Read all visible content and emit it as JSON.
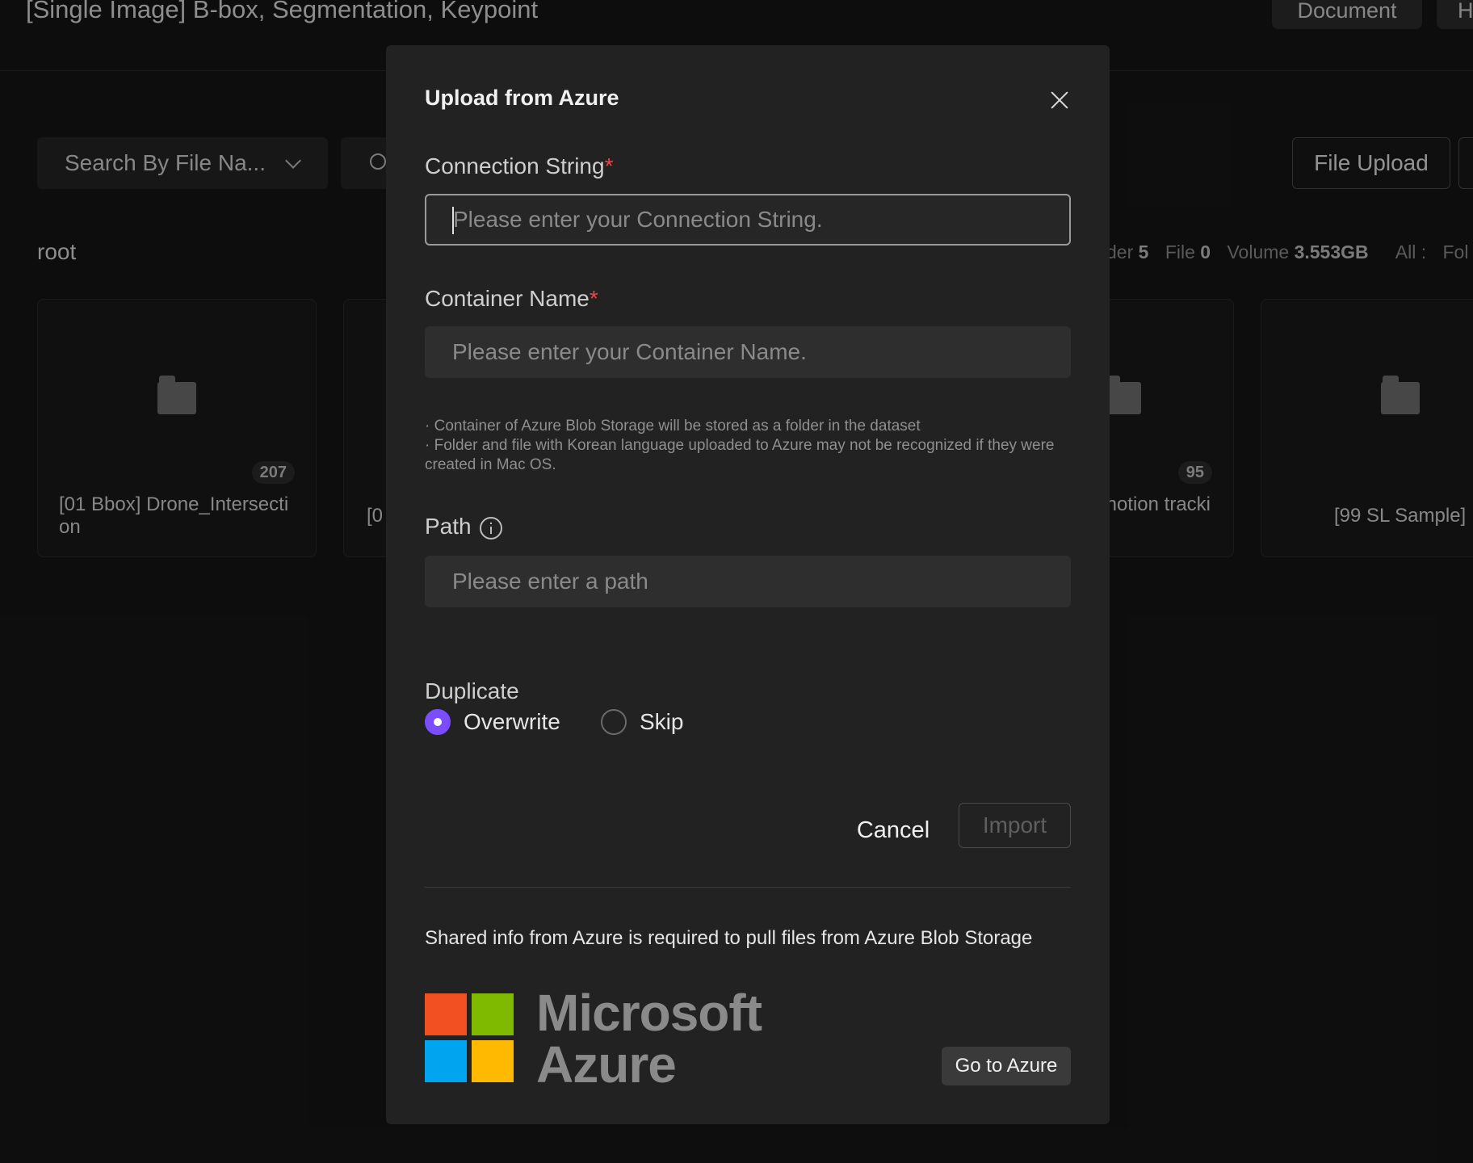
{
  "header": {
    "title": "[Single Image] B-box, Segmentation, Keypoint",
    "document_label": "Document",
    "more_label": "H"
  },
  "toolbar": {
    "search_select_label": "Search By File Na...",
    "file_upload_label": "File Upload"
  },
  "breadcrumb": {
    "root": "root"
  },
  "stats": {
    "folder_label": "der",
    "folder_value": "5",
    "file_label": "File",
    "file_value": "0",
    "volume_label": "Volume",
    "volume_value": "3.553GB",
    "all_label": "All :",
    "all_value": "Fol"
  },
  "cards": [
    {
      "name": "[01 Bbox] Drone_Intersecti on",
      "count": "207"
    },
    {
      "name": "[0"
    },
    {
      "name": "notion tracki",
      "count": "95"
    },
    {
      "name": "[99 SL Sample]"
    }
  ],
  "modal": {
    "title": "Upload from Azure",
    "connection": {
      "label": "Connection String",
      "required": "*",
      "placeholder": "Please enter your Connection String.",
      "value": ""
    },
    "container": {
      "label": "Container Name",
      "required": "*",
      "placeholder": "Please enter your Container Name.",
      "value": ""
    },
    "notes": [
      "· Container of Azure Blob Storage will be stored as a folder in the dataset",
      "· Folder and file with Korean language uploaded to Azure may not be recognized if they were created in Mac OS."
    ],
    "path": {
      "label": "Path",
      "placeholder": "Please enter a path",
      "value": ""
    },
    "duplicate": {
      "label": "Duplicate",
      "options": [
        "Overwrite",
        "Skip"
      ],
      "selected": "Overwrite"
    },
    "cancel_label": "Cancel",
    "import_label": "Import",
    "shared_info": "Shared info from Azure is required to pull files from Azure Blob Storage",
    "logo_text_line1": "Microsoft",
    "logo_text_line2": "Azure",
    "go_azure_label": "Go to Azure"
  },
  "colors": {
    "accent": "#7b4dff",
    "required": "#e5484d",
    "ms_red": "#f25022",
    "ms_green": "#7fba00",
    "ms_blue": "#00a4ef",
    "ms_yellow": "#ffb900"
  }
}
